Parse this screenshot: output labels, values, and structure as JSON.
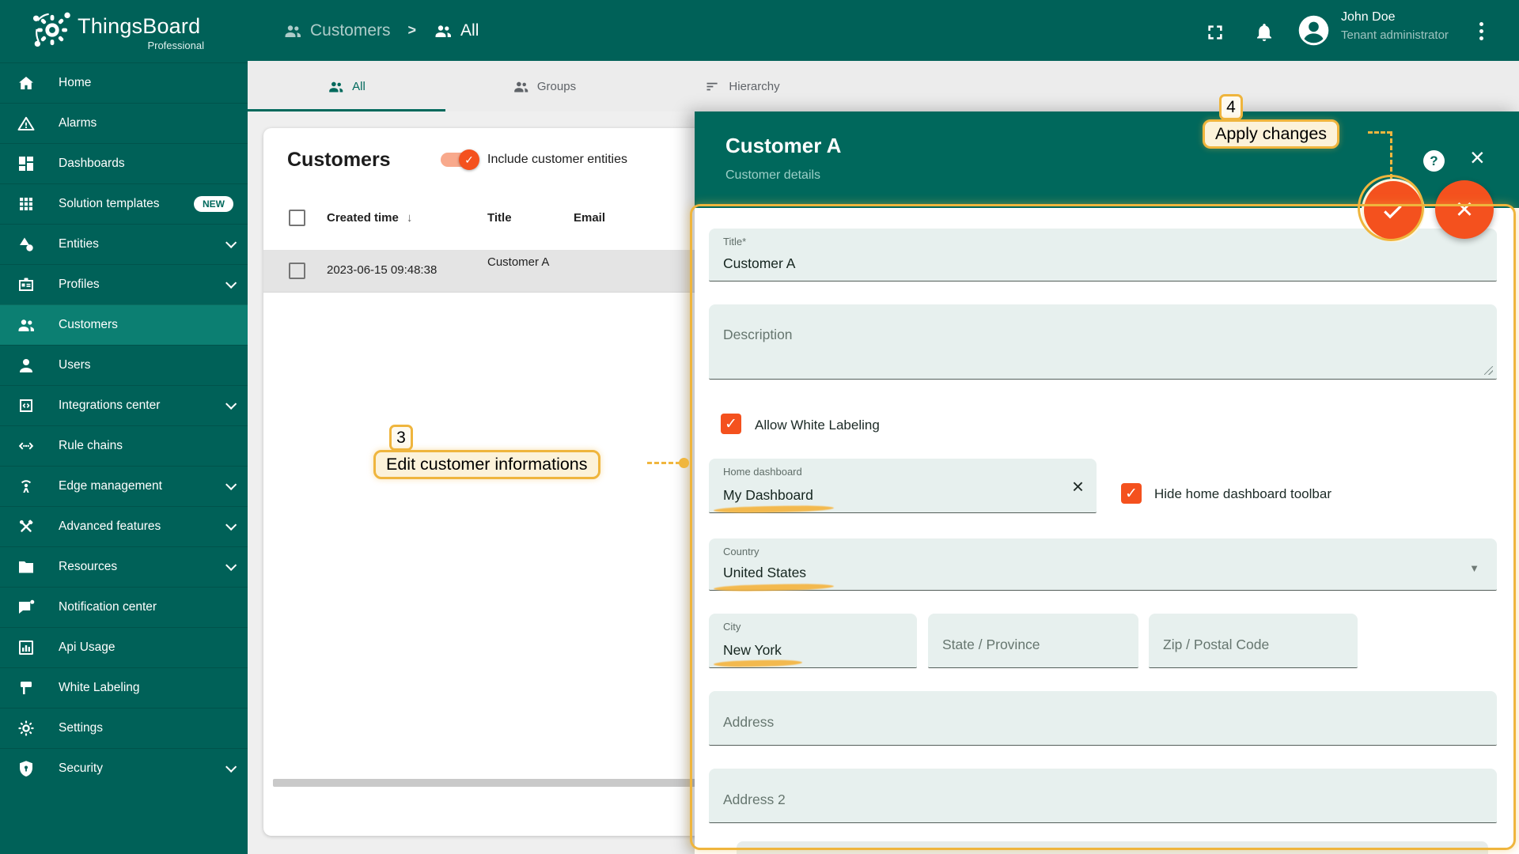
{
  "brand": {
    "name": "ThingsBoard",
    "edition": "Professional"
  },
  "breadcrumb": {
    "separator": ">",
    "items": [
      {
        "label": "Customers"
      },
      {
        "label": "All"
      }
    ]
  },
  "topbar": {
    "user": {
      "name": "John Doe",
      "role": "Tenant administrator"
    }
  },
  "sidebar": {
    "items": [
      {
        "label": "Home",
        "icon": "home-icon"
      },
      {
        "label": "Alarms",
        "icon": "alarms-icon"
      },
      {
        "label": "Dashboards",
        "icon": "dashboards-icon"
      },
      {
        "label": "Solution templates",
        "icon": "solution-templates-icon",
        "badge": "NEW"
      },
      {
        "label": "Entities",
        "icon": "entities-icon",
        "expandable": true
      },
      {
        "label": "Profiles",
        "icon": "profiles-icon",
        "expandable": true
      },
      {
        "label": "Customers",
        "icon": "customers-icon",
        "active": true
      },
      {
        "label": "Users",
        "icon": "users-icon"
      },
      {
        "label": "Integrations center",
        "icon": "integrations-icon",
        "expandable": true
      },
      {
        "label": "Rule chains",
        "icon": "rule-chains-icon"
      },
      {
        "label": "Edge management",
        "icon": "edge-management-icon",
        "expandable": true
      },
      {
        "label": "Advanced features",
        "icon": "advanced-features-icon",
        "expandable": true
      },
      {
        "label": "Resources",
        "icon": "resources-icon",
        "expandable": true
      },
      {
        "label": "Notification center",
        "icon": "notification-center-icon"
      },
      {
        "label": "Api Usage",
        "icon": "api-usage-icon"
      },
      {
        "label": "White Labeling",
        "icon": "white-labeling-icon"
      },
      {
        "label": "Settings",
        "icon": "settings-icon"
      },
      {
        "label": "Security",
        "icon": "security-icon",
        "expandable": true
      }
    ]
  },
  "tabs": [
    {
      "label": "All",
      "active": true
    },
    {
      "label": "Groups",
      "active": false
    },
    {
      "label": "Hierarchy",
      "active": false
    }
  ],
  "customers_table": {
    "title": "Customers",
    "toggle_label": "Include customer entities",
    "toggle_checked": true,
    "columns": [
      "Created time",
      "Title",
      "Email"
    ],
    "sort_arrow": "↓",
    "rows": [
      {
        "created_time": "2023-06-15 09:48:38",
        "title": "Customer A",
        "email": ""
      }
    ]
  },
  "details_panel": {
    "title": "Customer A",
    "subtitle": "Customer details",
    "help_glyph": "?",
    "fields": {
      "title": {
        "label": "Title*",
        "value": "Customer A"
      },
      "description": {
        "placeholder": "Description"
      },
      "home_dashboard": {
        "label": "Home dashboard",
        "value": "My Dashboard"
      },
      "country": {
        "label": "Country",
        "value": "United States"
      },
      "city": {
        "label": "City",
        "value": "New York"
      },
      "state": {
        "placeholder": "State / Province"
      },
      "zip": {
        "placeholder": "Zip / Postal Code"
      },
      "address": {
        "placeholder": "Address"
      },
      "address2": {
        "placeholder": "Address 2"
      }
    },
    "checkboxes": {
      "allow_white_labeling": {
        "label": "Allow White Labeling",
        "checked": true
      },
      "hide_home_dashboard_toolbar": {
        "label": "Hide home dashboard toolbar",
        "checked": true
      }
    }
  },
  "annotations": {
    "step3": {
      "number": "3",
      "label": "Edit customer informations"
    },
    "step4": {
      "number": "4",
      "label": "Apply changes"
    }
  },
  "colors": {
    "primary_teal": "#00685c",
    "accent_orange": "#f4511e",
    "annotation_amber": "#efb53d",
    "field_bg": "#e7f0ee"
  }
}
